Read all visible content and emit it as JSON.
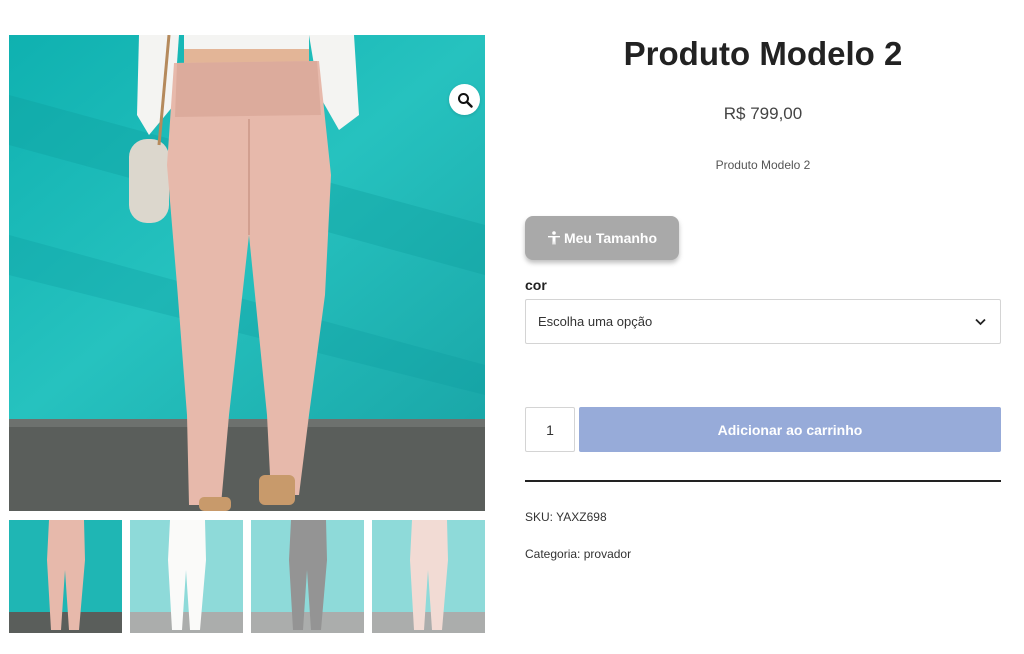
{
  "product": {
    "title": "Produto Modelo 2",
    "price": "R$ 799,00",
    "short_description": "Produto Modelo 2"
  },
  "size_button": {
    "label": "Meu Tamanho",
    "icon": "person-icon",
    "color": "#a9a9a9"
  },
  "variation": {
    "label": "cor",
    "selected": "Escolha uma opção"
  },
  "cart": {
    "quantity": "1",
    "add_label": "Adicionar ao carrinho",
    "button_color": "#97abd9"
  },
  "meta": {
    "sku_label": "SKU:",
    "sku": "YAXZ698",
    "category_label": "Categoria:",
    "category": "provador"
  },
  "gallery": {
    "main_alt": "pink paperbag-waist pants on teal background",
    "zoom_icon": "magnifier-icon",
    "thumbnails": [
      "pink pants",
      "white pants",
      "black pants",
      "pink pants"
    ]
  },
  "colors": {
    "teal_background": "#1fb6b4",
    "pink_pants": "#e7b9ab"
  }
}
